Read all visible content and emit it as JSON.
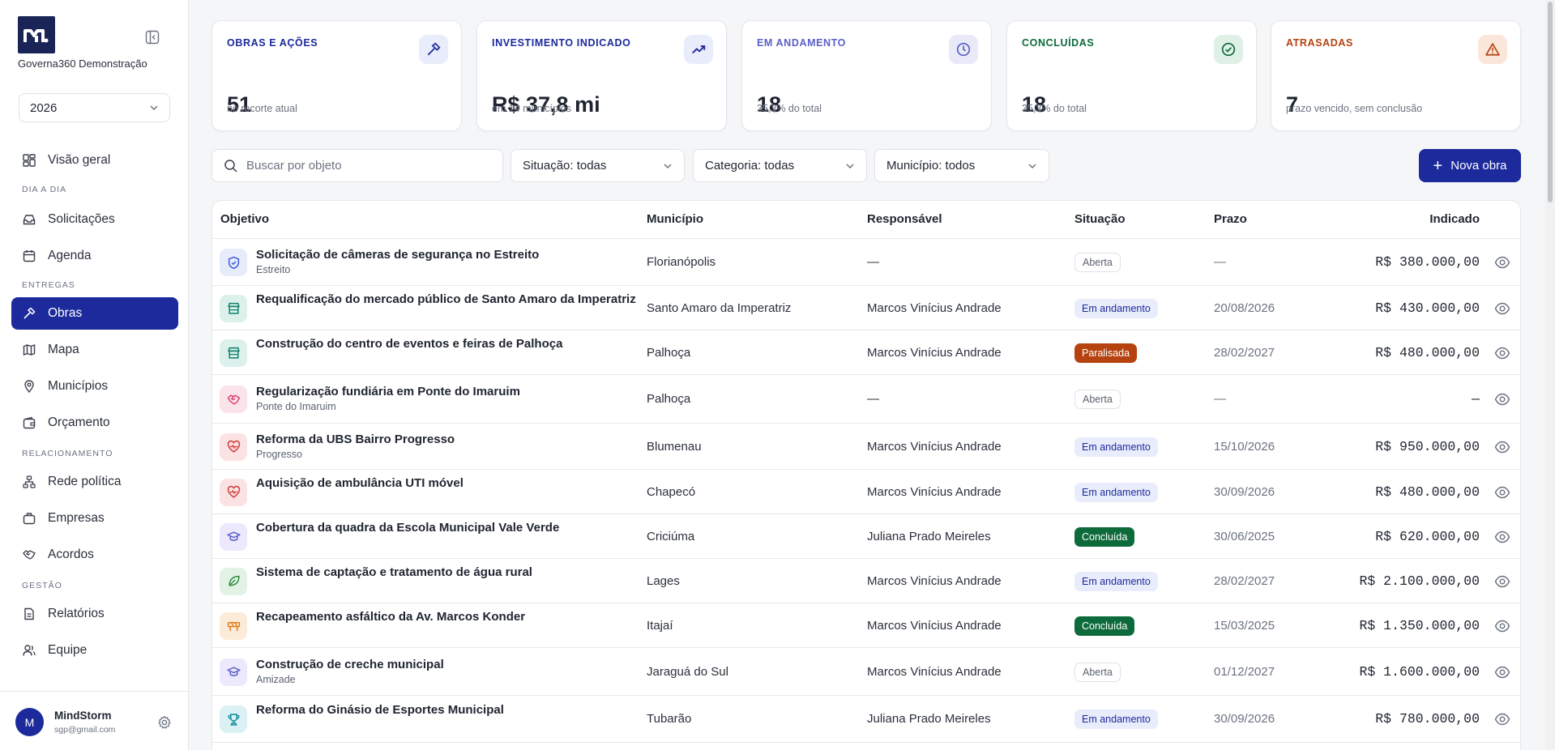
{
  "sidebar": {
    "org_name": "Governa360 Demonstração",
    "year": "2026",
    "nav": {
      "visao_geral": "Visão geral",
      "section_dia": "DIA A DIA",
      "solicitacoes": "Solicitações",
      "agenda": "Agenda",
      "section_entregas": "ENTREGAS",
      "obras": "Obras",
      "mapa": "Mapa",
      "municipios": "Municípios",
      "orcamento": "Orçamento",
      "section_relac": "RELACIONAMENTO",
      "rede_politica": "Rede política",
      "empresas": "Empresas",
      "acordos": "Acordos",
      "section_gestao": "GESTÃO",
      "relatorios": "Relatórios",
      "equipe": "Equipe"
    },
    "user": {
      "initial": "M",
      "name": "MindStorm",
      "email": "sgp@gmail.com"
    }
  },
  "stats": [
    {
      "label": "OBRAS E AÇÕES",
      "value": "51",
      "sub": "no recorte atual",
      "color": "#1c2a9c",
      "icon": "hammer-icon"
    },
    {
      "label": "INVESTIMENTO INDICADO",
      "value": "R$ 37,8 mi",
      "sub": "em 14 municípios",
      "color": "#1c2a9c",
      "icon": "trend-up-icon"
    },
    {
      "label": "EM ANDAMENTO",
      "value": "18",
      "sub": "35,3% do total",
      "color": "#5b5fc7",
      "icon": "clock-icon"
    },
    {
      "label": "CONCLUÍDAS",
      "value": "18",
      "sub": "35,3% do total",
      "color": "#0d6b3b",
      "icon": "check-circle-icon"
    },
    {
      "label": "ATRASADAS",
      "value": "7",
      "sub": "prazo vencido, sem conclusão",
      "color": "#b6420f",
      "icon": "alert-icon"
    }
  ],
  "filters": {
    "search_placeholder": "Buscar por objeto",
    "situacao": "Situação: todas",
    "categoria": "Categoria: todas",
    "municipio": "Município: todos",
    "new_button": "Nova obra"
  },
  "table": {
    "headers": {
      "objetivo": "Objetivo",
      "municipio": "Município",
      "responsavel": "Responsável",
      "situacao": "Situação",
      "prazo": "Prazo",
      "indicado": "Indicado"
    },
    "rows": [
      {
        "icon": "shield-icon",
        "title": "Solicitação de câmeras de segurança no Estreito",
        "subtitle": "Estreito",
        "municipio": "Florianópolis",
        "responsavel": "—",
        "situacao": "Aberta",
        "status": "aberta",
        "prazo": "—",
        "indicado": "R$ 380.000,00"
      },
      {
        "icon": "store-icon",
        "title": "Requalificação do mercado público de Santo Amaro da Imperatriz",
        "subtitle": "",
        "municipio": "Santo Amaro da Imperatriz",
        "responsavel": "Marcos Vinícius Andrade",
        "situacao": "Em andamento",
        "status": "andamento",
        "prazo": "20/08/2026",
        "indicado": "R$ 430.000,00"
      },
      {
        "icon": "store-icon",
        "title": "Construção do centro de eventos e feiras de Palhoça",
        "subtitle": "",
        "municipio": "Palhoça",
        "responsavel": "Marcos Vinícius Andrade",
        "situacao": "Paralisada",
        "status": "paralisada",
        "prazo": "28/02/2027",
        "indicado": "R$ 480.000,00"
      },
      {
        "icon": "handshake-icon",
        "title": "Regularização fundiária em Ponte do Imaruim",
        "subtitle": "Ponte do Imaruim",
        "municipio": "Palhoça",
        "responsavel": "—",
        "situacao": "Aberta",
        "status": "aberta",
        "prazo": "—",
        "indicado": "—"
      },
      {
        "icon": "heart-pulse-icon",
        "title": "Reforma da UBS Bairro Progresso",
        "subtitle": "Progresso",
        "municipio": "Blumenau",
        "responsavel": "Marcos Vinícius Andrade",
        "situacao": "Em andamento",
        "status": "andamento",
        "prazo": "15/10/2026",
        "indicado": "R$ 950.000,00"
      },
      {
        "icon": "heart-pulse-icon",
        "title": "Aquisição de ambulância UTI móvel",
        "subtitle": "",
        "municipio": "Chapecó",
        "responsavel": "Marcos Vinícius Andrade",
        "situacao": "Em andamento",
        "status": "andamento",
        "prazo": "30/09/2026",
        "indicado": "R$ 480.000,00"
      },
      {
        "icon": "graduation-cap-icon",
        "title": "Cobertura da quadra da Escola Municipal Vale Verde",
        "subtitle": "",
        "municipio": "Criciúma",
        "responsavel": "Juliana Prado Meireles",
        "situacao": "Concluída",
        "status": "concluida",
        "prazo": "30/06/2025",
        "indicado": "R$ 620.000,00"
      },
      {
        "icon": "leaf-icon",
        "title": "Sistema de captação e tratamento de água rural",
        "subtitle": "",
        "municipio": "Lages",
        "responsavel": "Marcos Vinícius Andrade",
        "situacao": "Em andamento",
        "status": "andamento",
        "prazo": "28/02/2027",
        "indicado": "R$ 2.100.000,00"
      },
      {
        "icon": "road-barrier-icon",
        "title": "Recapeamento asfáltico da Av. Marcos Konder",
        "subtitle": "",
        "municipio": "Itajaí",
        "responsavel": "Marcos Vinícius Andrade",
        "situacao": "Concluída",
        "status": "concluida",
        "prazo": "15/03/2025",
        "indicado": "R$ 1.350.000,00"
      },
      {
        "icon": "graduation-cap-icon",
        "title": "Construção de creche municipal",
        "subtitle": "Amizade",
        "municipio": "Jaraguá do Sul",
        "responsavel": "Marcos Vinícius Andrade",
        "situacao": "Aberta",
        "status": "aberta",
        "prazo": "01/12/2027",
        "indicado": "R$ 1.600.000,00"
      },
      {
        "icon": "trophy-icon",
        "title": "Reforma do Ginásio de Esportes Municipal",
        "subtitle": "",
        "municipio": "Tubarão",
        "responsavel": "Juliana Prado Meireles",
        "situacao": "Em andamento",
        "status": "andamento",
        "prazo": "30/09/2026",
        "indicado": "R$ 780.000,00"
      }
    ]
  }
}
